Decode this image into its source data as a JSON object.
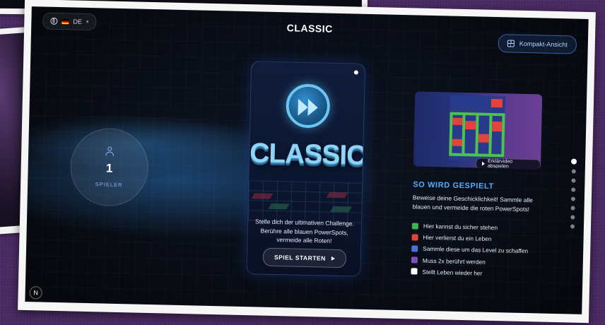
{
  "header": {
    "language_code": "DE",
    "page_title": "CLASSIC",
    "compact_view_label": "Kompakt-Ansicht"
  },
  "player": {
    "count": "1",
    "label": "SPIELER"
  },
  "mode_card": {
    "title": "CLASSIC",
    "description": "Stelle dich der ultimativen Challenge. Berühre alle blauen PowerSpots, vermeide alle Roten!",
    "start_button_label": "SPIEL STARTEN"
  },
  "video": {
    "play_label": "Erklärvideo abspielen"
  },
  "how_to_play": {
    "title": "SO WIRD GESPIELT",
    "description": "Beweise deine Geschicklichkeit! Sammle alle blauen und vermeide die roten PowerSpots!",
    "legend": [
      {
        "color": "#3fb34f",
        "label": "Hier kannst du sicher stehen"
      },
      {
        "color": "#e0443c",
        "label": "Hier verlierst du ein Leben"
      },
      {
        "color": "#4f6fd8",
        "label": "Sammle diese um das Level zu schaffen"
      },
      {
        "color": "#7b4fc2",
        "label": "Muss 2x berührt werden"
      },
      {
        "color": "#ffffff",
        "label": "Stellt Leben wieder her"
      }
    ]
  },
  "pagination": {
    "total": 8,
    "active_index": 0
  },
  "footer": {
    "badge": "N"
  }
}
